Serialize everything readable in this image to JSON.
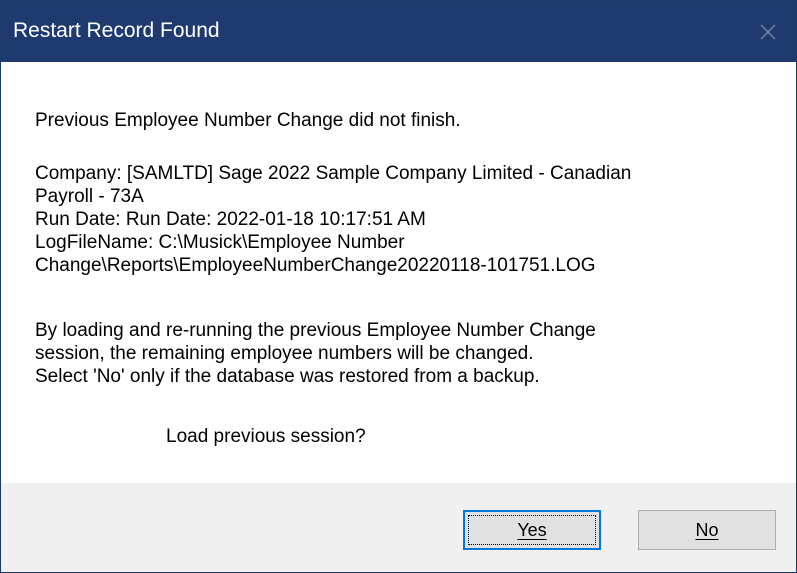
{
  "window": {
    "title": "Restart Record Found"
  },
  "message": {
    "line1": "Previous Employee Number Change did not finish.",
    "company_line1": "Company:  [SAMLTD] Sage 2022 Sample Company Limited  - Canadian",
    "company_line2": "Payroll - 73A",
    "run_date": "Run Date: Run Date: 2022-01-18  10:17:51 AM",
    "logfile_line1": "LogFileName: C:\\Musick\\Employee Number",
    "logfile_line2": "Change\\Reports\\EmployeeNumberChange20220118-101751.LOG",
    "info_line1": "By loading and re-running the previous Employee Number Change",
    "info_line2": "session, the remaining employee numbers will be changed.",
    "info_line3": "Select 'No' only if the database was restored from a backup.",
    "question": "Load previous session?"
  },
  "buttons": {
    "yes_label": "Yes",
    "no_label": "No"
  },
  "colors": {
    "titlebar": "#1f3a6e",
    "default_button_border": "#0078d7",
    "footer": "#f0f0f0"
  },
  "icons": {
    "close": "close-icon"
  }
}
